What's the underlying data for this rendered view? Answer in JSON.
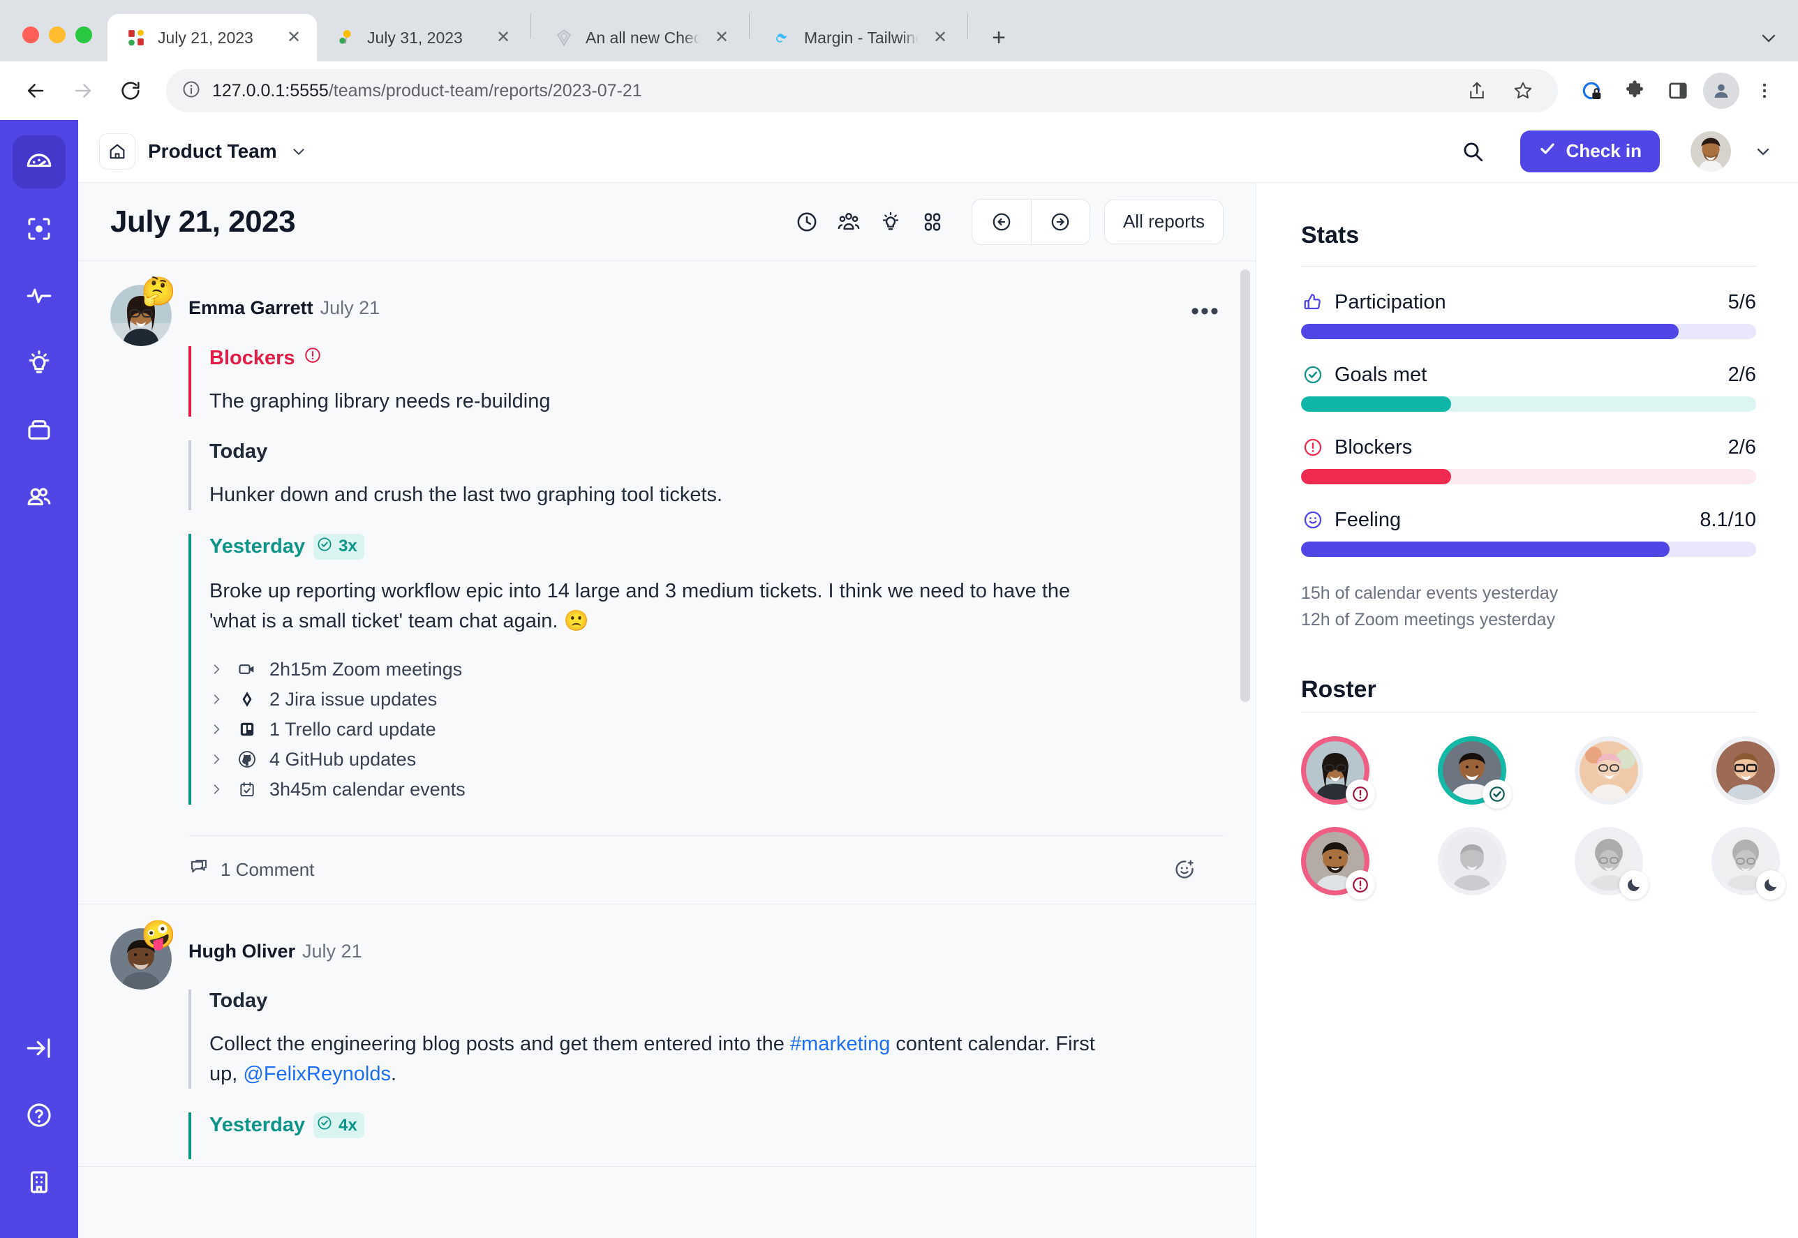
{
  "browser": {
    "tabs": [
      {
        "title": "July 21, 2023",
        "favicon": "grid-squares-icon",
        "active": true
      },
      {
        "title": "July 31, 2023",
        "favicon": "balloon-icon",
        "active": false
      },
      {
        "title": "An all new Check-in dashboard",
        "favicon": "diamond-icon",
        "active": false
      },
      {
        "title": "Margin - Tailwind CSS",
        "favicon": "tailwind-icon",
        "active": false
      }
    ],
    "new_tab_label": "+",
    "close_label": "✕",
    "url_prefix": "127.0.0.1:5555",
    "url_path": "/teams/product-team/reports/2023-07-21",
    "toolbar_icons": [
      "share-icon",
      "bookmark-star-icon",
      "privacy-lock-icon",
      "extensions-puzzle-icon",
      "side-panel-icon",
      "profile-icon",
      "more-vertical-icon"
    ]
  },
  "rail": {
    "items": [
      {
        "name": "dashboard-icon",
        "active": true
      },
      {
        "name": "focus-icon",
        "active": false
      },
      {
        "name": "pulse-icon",
        "active": false
      },
      {
        "name": "lightbulb-icon",
        "active": false
      },
      {
        "name": "archive-icon",
        "active": false
      },
      {
        "name": "people-icon",
        "active": false
      }
    ],
    "bottom_items": [
      {
        "name": "collapse-sidebar-icon"
      },
      {
        "name": "help-circle-icon"
      },
      {
        "name": "company-building-icon"
      }
    ]
  },
  "appheader": {
    "home_icon": "home-icon",
    "team_name": "Product Team",
    "team_chevron": "chevron-down-icon",
    "search_icon": "search-icon",
    "checkin_label": "Check in",
    "checkin_icon": "check-icon",
    "avatar_chevron": "chevron-down-icon"
  },
  "feed": {
    "title": "July 21, 2023",
    "tools": [
      "clock-icon",
      "people-group-icon",
      "lightbulb-icon",
      "grid-apps-icon"
    ],
    "prev_icon": "arrow-left-circle-icon",
    "next_icon": "arrow-right-circle-icon",
    "all_reports_label": "All reports",
    "posts": [
      {
        "author": "Emma Garrett",
        "date": "July 21",
        "emoji": "🤔",
        "more_label": "•••",
        "sections": [
          {
            "kind": "blockers",
            "title": "Blockers",
            "icon": "alert-circle-icon",
            "text": "The graphing library needs re-building"
          },
          {
            "kind": "today",
            "title": "Today",
            "text": "Hunker down and crush the last two graphing tool tickets."
          },
          {
            "kind": "yesterday",
            "title": "Yesterday",
            "badge": "3x",
            "badge_icon": "check-circle-icon",
            "text": "Broke up reporting workflow epic into 14 large and 3 medium tickets. I think we need to have the 'what is a small ticket' team chat again. 🙁"
          }
        ],
        "integrations": [
          {
            "icon": "video-camera-icon",
            "label": "2h15m Zoom meetings"
          },
          {
            "icon": "jira-icon",
            "label": "2 Jira issue updates"
          },
          {
            "icon": "trello-icon",
            "label": "1 Trello card update"
          },
          {
            "icon": "github-icon",
            "label": "4 GitHub updates"
          },
          {
            "icon": "calendar-check-icon",
            "label": "3h45m calendar events"
          }
        ],
        "comment_icon": "comment-icon",
        "comment_label": "1 Comment",
        "react_icon": "add-reaction-icon"
      },
      {
        "author": "Hugh Oliver",
        "date": "July 21",
        "emoji": "🤪",
        "sections": [
          {
            "kind": "today",
            "title": "Today",
            "text_parts": [
              {
                "t": "Collect the engineering blog posts and get them entered into the ",
                "link": false
              },
              {
                "t": "#marketing",
                "link": true
              },
              {
                "t": " content calendar. First up, ",
                "link": false
              },
              {
                "t": "@FelixReynolds",
                "link": true
              },
              {
                "t": ".",
                "link": false
              }
            ]
          },
          {
            "kind": "yesterday",
            "title": "Yesterday",
            "badge": "4x",
            "badge_icon": "check-circle-icon"
          }
        ]
      }
    ]
  },
  "sidebar": {
    "stats_heading": "Stats",
    "stats": [
      {
        "icon": "thumbs-up-icon",
        "label": "Participation",
        "value": "5/6",
        "pct": 83,
        "fill": "#4f46e5",
        "track": "#e8e7fb"
      },
      {
        "icon": "check-circle-icon",
        "label": "Goals met",
        "value": "2/6",
        "pct": 33,
        "fill": "#0fb6a8",
        "track": "#dcf5f2"
      },
      {
        "icon": "alert-circle-icon",
        "label": "Blockers",
        "value": "2/6",
        "pct": 33,
        "fill": "#ef2b52",
        "track": "#fdeaee"
      },
      {
        "icon": "smiley-icon",
        "label": "Feeling",
        "value": "8.1/10",
        "pct": 81,
        "fill": "#4f46e5",
        "track": "#e8e7fb"
      }
    ],
    "notes": [
      "15h of calendar events yesterday",
      "12h of Zoom meetings yesterday"
    ],
    "roster_heading": "Roster",
    "roster": [
      {
        "name": "member-1",
        "ring": "#ef5d82",
        "badge": "alert-icon",
        "badge_color": "#9f1239",
        "muted": false
      },
      {
        "name": "member-2",
        "ring": "#14b8a6",
        "badge": "check-icon",
        "badge_color": "#115e59",
        "muted": false
      },
      {
        "name": "member-3",
        "ring": "#eef0f4",
        "badge": null,
        "muted": false
      },
      {
        "name": "member-4",
        "ring": "#eef0f4",
        "badge": null,
        "muted": false
      },
      {
        "name": "member-5",
        "ring": "#ef5d82",
        "badge": "alert-icon",
        "badge_color": "#9f1239",
        "muted": false
      },
      {
        "name": "member-6",
        "ring": "#eef0f4",
        "badge": null,
        "muted": true
      },
      {
        "name": "member-7",
        "ring": "#eef0f4",
        "badge": "moon-icon",
        "badge_color": "#3b4252",
        "muted": true
      },
      {
        "name": "member-8",
        "ring": "#eef0f4",
        "badge": "moon-icon",
        "badge_color": "#3b4252",
        "muted": true
      }
    ]
  },
  "colors": {
    "brand": "#4f46e5",
    "danger": "#e11d48",
    "teal": "#0d9488",
    "link": "#1d6ef5"
  }
}
